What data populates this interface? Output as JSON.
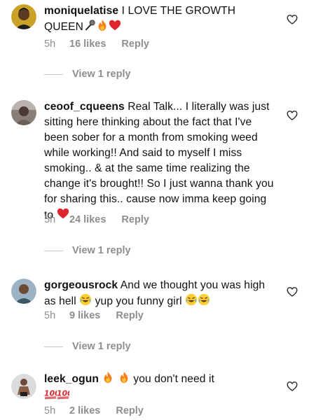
{
  "comments": [
    {
      "username": "moniquelatise",
      "text": "I LOVE THE GROWTH QUEEN",
      "time": "5h",
      "likes": "16 likes",
      "reply_label": "Reply",
      "view_replies": "View 1 reply",
      "emojis": [
        "microphone-icon",
        "fire-icon",
        "heart-icon"
      ]
    },
    {
      "username": "ceoof_cqueens",
      "text": "Real Talk... I literally was just sitting here thinking about the fact that I've been sober for a month from smoking weed while working!! And said to myself I miss smoking.. & at the same time realizing the change it's brought!! So I just wanna thank you for sharing this.. cause now imma keep going to",
      "time": "5h",
      "likes": "24 likes",
      "reply_label": "Reply",
      "view_replies": "View 1 reply",
      "emojis": [
        "heart-icon"
      ]
    },
    {
      "username": "gorgeousrock",
      "text_part1": "And we thought you was high as hell",
      "text_part2": "yup you funny girl",
      "time": "5h",
      "likes": "9 likes",
      "reply_label": "Reply",
      "view_replies": "View 1 reply",
      "emojis": [
        "laughing-crying-icon",
        "laughing-crying-icon",
        "laughing-crying-icon"
      ]
    },
    {
      "username": "leek_ogun",
      "text": "you don't need it",
      "time": "5h",
      "likes": "2 likes",
      "reply_label": "Reply",
      "emojis": [
        "fire-icon",
        "fire-icon",
        "hundred-icon",
        "hundred-icon"
      ]
    }
  ],
  "colors": {
    "meta": "#8e8e8e",
    "heart": "#e0262d",
    "fire": "#f5811e"
  }
}
